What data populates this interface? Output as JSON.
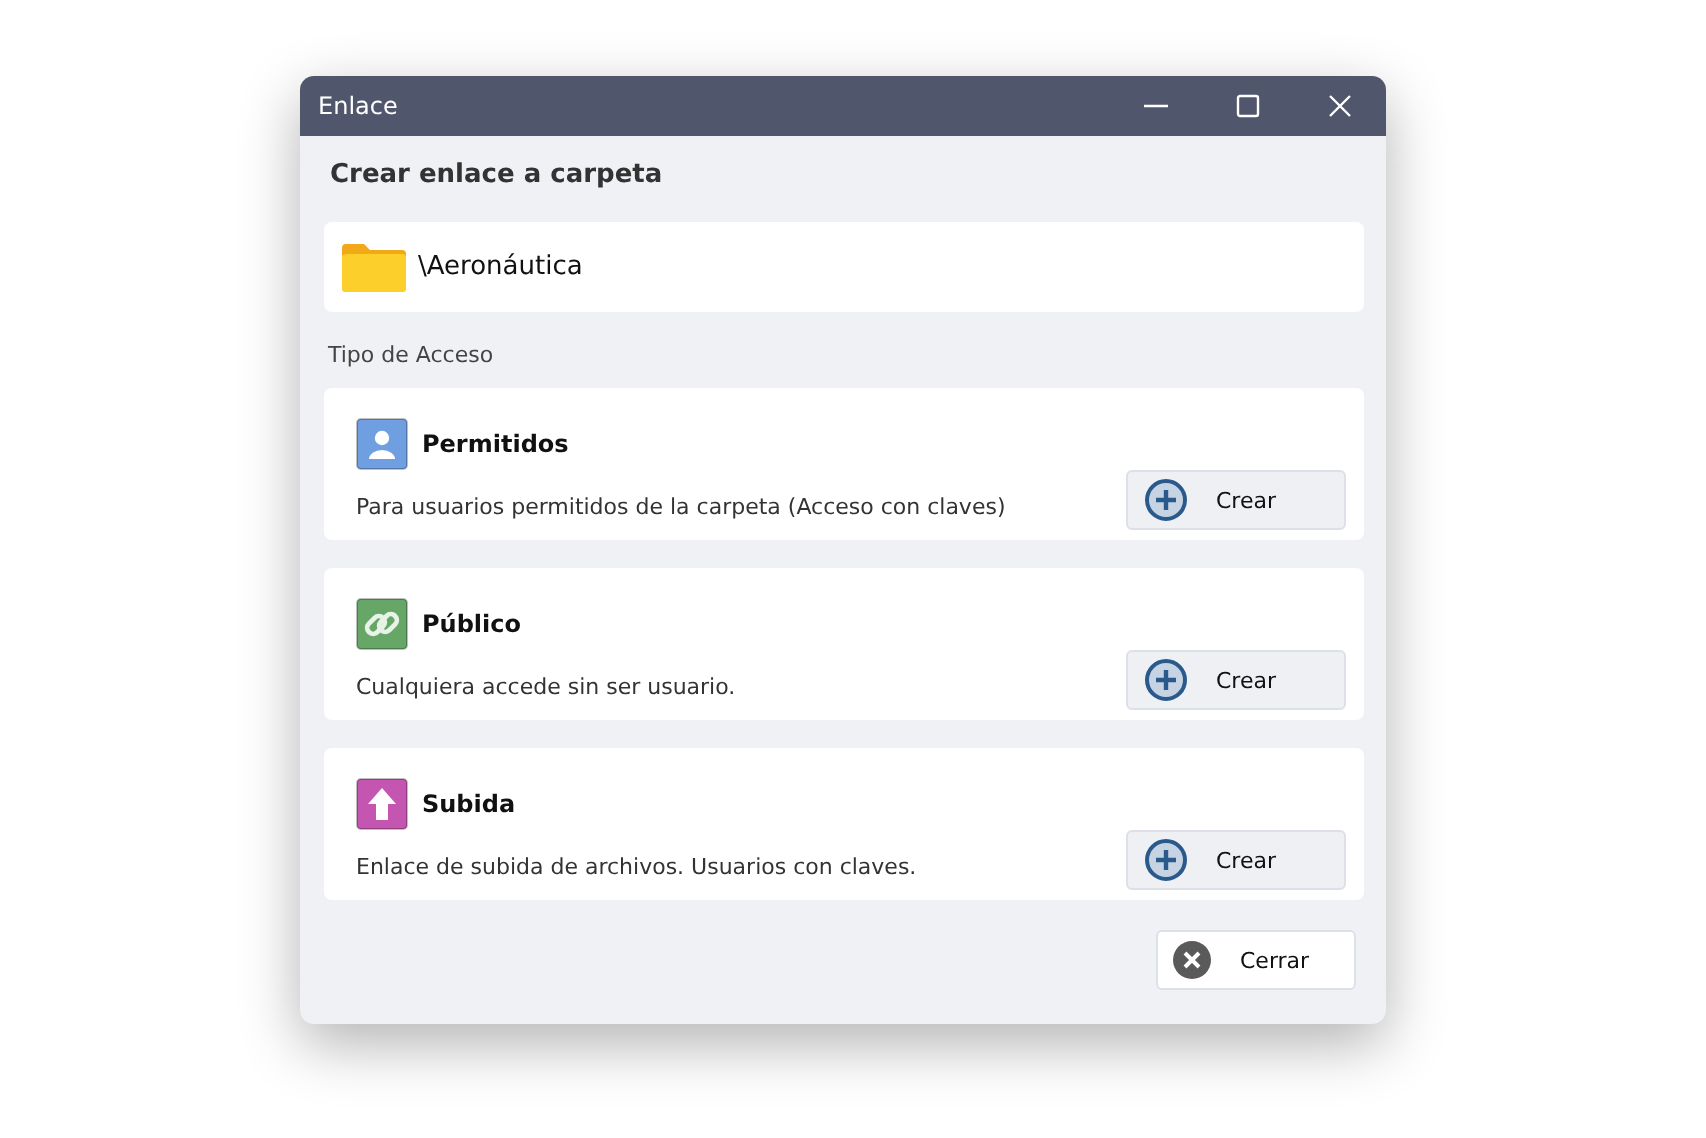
{
  "window": {
    "title": "Enlace"
  },
  "heading": "Crear enlace a carpeta",
  "folder": {
    "path": "\\Aeronáutica"
  },
  "section_label": "Tipo de Acceso",
  "access_types": [
    {
      "kind": "user",
      "color": "#6f9fe0",
      "title": "Permitidos",
      "description": "Para usuarios permitidos de la carpeta (Acceso con claves)",
      "button": "Crear"
    },
    {
      "kind": "link",
      "color": "#66a666",
      "title": "Público",
      "description": "Cualquiera accede sin ser usuario.",
      "button": "Crear"
    },
    {
      "kind": "upload",
      "color": "#c455b0",
      "title": "Subida",
      "description": "Enlace de subida de archivos. Usuarios con claves.",
      "button": "Crear"
    }
  ],
  "close_button": "Cerrar"
}
